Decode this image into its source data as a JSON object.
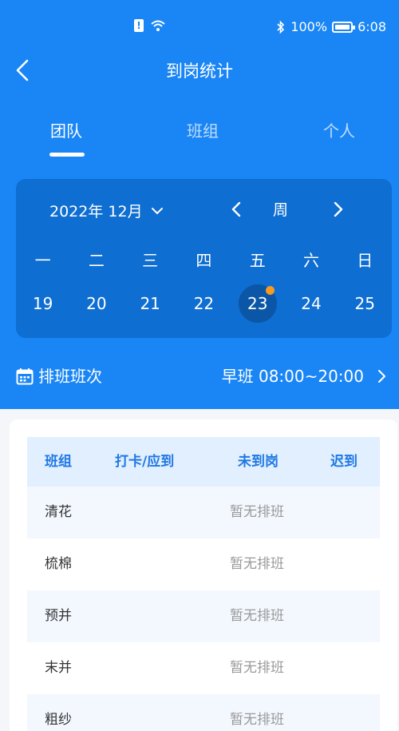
{
  "status_bar": {
    "battery": "100%",
    "time": "6:08"
  },
  "title": "到岗统计",
  "tabs": [
    {
      "label": "团队",
      "active": true
    },
    {
      "label": "班组",
      "active": false
    },
    {
      "label": "个人",
      "active": false
    }
  ],
  "calendar": {
    "month": "2022年 12月",
    "view": "周",
    "weekdays": [
      "一",
      "二",
      "三",
      "四",
      "五",
      "六",
      "日"
    ],
    "dates": [
      "19",
      "20",
      "21",
      "22",
      "23",
      "24",
      "25"
    ],
    "selected_date": "23"
  },
  "shift": {
    "label": "排班班次",
    "value": "早班 08:00~20:00"
  },
  "table": {
    "headers": [
      "班组",
      "打卡/应到",
      "未到岗",
      "迟到"
    ],
    "rows": [
      {
        "group": "清花",
        "status": "暂无排班"
      },
      {
        "group": "梳棉",
        "status": "暂无排班"
      },
      {
        "group": "预并",
        "status": "暂无排班"
      },
      {
        "group": "末并",
        "status": "暂无排班"
      },
      {
        "group": "粗纱",
        "status": "暂无排班"
      }
    ]
  },
  "colors": {
    "header_blue": "#1a86f5",
    "calendar_blue": "#0e6ed1",
    "selected_circle": "#0b56a6",
    "dot_orange": "#f59b22",
    "table_header_bg": "#e1effe",
    "table_header_text": "#1f78e4"
  }
}
